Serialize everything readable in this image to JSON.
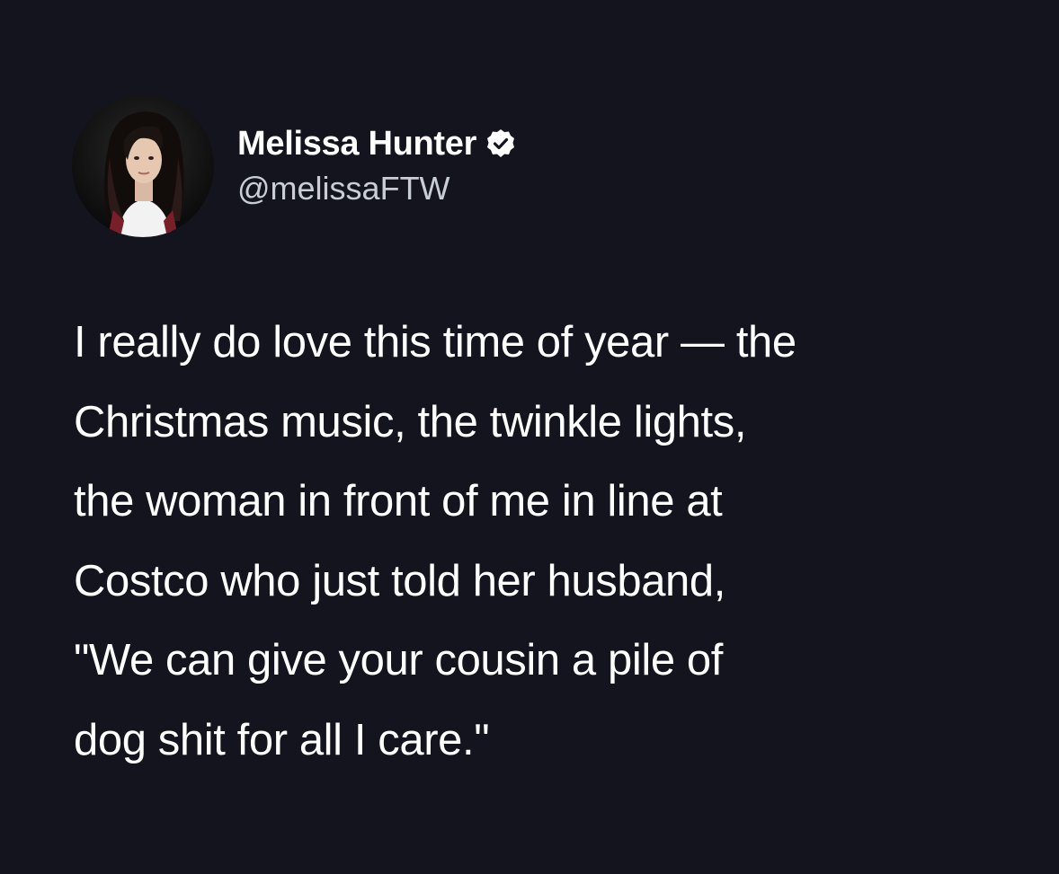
{
  "tweet": {
    "author": {
      "display_name": "Melissa Hunter",
      "handle": "@melissaFTW",
      "verified": true,
      "avatar_icon": "profile-photo",
      "verified_icon": "verified-badge-icon"
    },
    "text_lines": [
      "I really do love this time of year — the",
      "Christmas music, the twinkle lights,",
      "the woman in front of me in line at",
      "Costco who just told her husband,",
      "\"We can give your cousin a pile of",
      "dog shit for all I care.\""
    ]
  },
  "colors": {
    "background": "#14141f",
    "text_primary": "#ffffff",
    "text_secondary": "#c9ced6"
  }
}
